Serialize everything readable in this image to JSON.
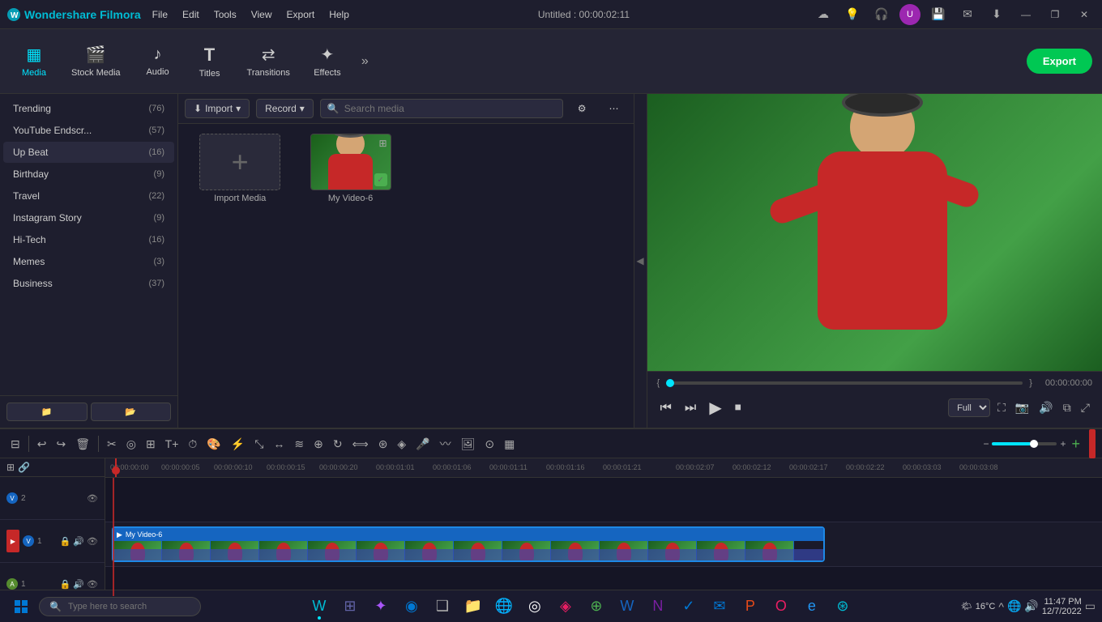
{
  "app": {
    "name": "Wondershare Filmora",
    "title": "Untitled : 00:00:02:11"
  },
  "titlebar": {
    "menu_items": [
      "File",
      "Edit",
      "Tools",
      "View",
      "Export",
      "Help"
    ],
    "window_controls": [
      "minimize",
      "maximize",
      "close"
    ]
  },
  "toolbar": {
    "items": [
      {
        "id": "media",
        "label": "Media",
        "icon": "▦",
        "active": true
      },
      {
        "id": "stock_media",
        "label": "Stock Media",
        "icon": "🎬"
      },
      {
        "id": "audio",
        "label": "Audio",
        "icon": "♪"
      },
      {
        "id": "titles",
        "label": "Titles",
        "icon": "T"
      },
      {
        "id": "transitions",
        "label": "Transitions",
        "icon": "⇄"
      },
      {
        "id": "effects",
        "label": "Effects",
        "icon": "✦"
      }
    ],
    "expand_icon": "»",
    "export_label": "Export"
  },
  "sidebar": {
    "items": [
      {
        "label": "Trending",
        "count": "(76)"
      },
      {
        "label": "YouTube Endscr...",
        "count": "(57)"
      },
      {
        "label": "Up Beat",
        "count": "(16)"
      },
      {
        "label": "Birthday",
        "count": "(9)"
      },
      {
        "label": "Travel",
        "count": "(22)"
      },
      {
        "label": "Instagram Story",
        "count": "(9)"
      },
      {
        "label": "Hi-Tech",
        "count": "(16)"
      },
      {
        "label": "Memes",
        "count": "(3)"
      },
      {
        "label": "Business",
        "count": "(37)"
      }
    ],
    "footer_btn1": "📁",
    "footer_btn2": "📂"
  },
  "content": {
    "import_label": "Import",
    "record_label": "Record",
    "search_placeholder": "Search media",
    "import_media_label": "Import Media",
    "video_name": "My Video-6"
  },
  "preview": {
    "progress": "0",
    "time_left": "[",
    "time_right": "]",
    "current_time": "00:00:00:00",
    "quality": "Full",
    "controls": {
      "prev": "⏮",
      "back": "⏭",
      "play": "▶",
      "stop": "⏹"
    }
  },
  "timeline": {
    "tracks": [
      {
        "num": "2",
        "type": "video",
        "label": ""
      },
      {
        "num": "1",
        "type": "video",
        "label": "My Video-6"
      },
      {
        "num": "1",
        "type": "audio",
        "label": ""
      }
    ],
    "clip_name": "My Video-6",
    "ruler_marks": [
      "00:00:00:00",
      "00:00:00:05",
      "00:00:00:10",
      "00:00:00:15",
      "00:00:00:20",
      "00:00:01:01",
      "00:00:01:06",
      "00:00:01:11",
      "00:00:01:16",
      "00:00:01:21",
      "00:00:02:07",
      "00:00:02:12",
      "00:00:02:17",
      "00:00:02:22",
      "00:00:03:03",
      "00:00:03:08"
    ]
  },
  "taskbar": {
    "search_placeholder": "Type here to search",
    "apps": [
      {
        "name": "windows-start",
        "icon": "⊞"
      },
      {
        "name": "task-view",
        "icon": "❑"
      },
      {
        "name": "edge-browser",
        "icon": "🌐"
      },
      {
        "name": "file-explorer",
        "icon": "📁"
      },
      {
        "name": "windows-store",
        "icon": "🏪"
      }
    ],
    "sys_tray": {
      "temperature": "16°C",
      "time": "11:47 PM",
      "date": "12/7/2022"
    }
  }
}
